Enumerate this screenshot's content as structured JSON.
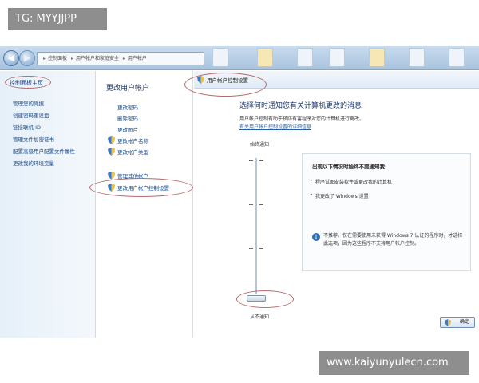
{
  "watermarks": {
    "top": "TG: MYYJJPP",
    "bottom": "www.kaiyunyulecn.com"
  },
  "addressbar": {
    "back_glyph": "◀",
    "forward_glyph": "▶",
    "segments": [
      "控制面板",
      "用户帐户和家庭安全",
      "用户帐户"
    ]
  },
  "left_nav": {
    "home": "控制面板主页",
    "items": [
      "管理您的凭据",
      "创建密码重设盘",
      "链接联机 ID",
      "管理文件加密证书",
      "配置高级用户配置文件属性",
      "更改我的环境变量"
    ]
  },
  "middle": {
    "title": "更改用户帐户",
    "links": [
      "更改密码",
      "删除密码",
      "更改图片",
      "更改帐户名称",
      "更改帐户类型",
      "管理其他帐户",
      "更改用户帐户控制设置"
    ]
  },
  "uac": {
    "header": "用户帐户控制设置",
    "heading": "选择何时通知您有关计算机更改的消息",
    "description": "用户帐户控制有助于预防有害程序对您的计算机进行更改。",
    "link": "有关用户帐户控制设置的详细信息",
    "slider": {
      "top_label": "始终通知",
      "bottom_label": "从不通知",
      "level": 0,
      "levels": 4
    },
    "info": {
      "heading": "出现以下情况时始终不要通知我:",
      "bullets": [
        "程序试图安装软件或更改我的计算机",
        "我更改了 Windows 设置"
      ],
      "note": "不推荐。仅在需要使用未获得 Windows 7 认证的程序时，才选择此选项，因为这些程序不支持用户帐户控制。"
    },
    "ok_button": "确定"
  },
  "colors": {
    "link": "#1a4c8e",
    "annotation": "#b66a6a",
    "heading": "#1e3b6f"
  },
  "icons": {
    "shield": "uac-shield-icon",
    "info": "info-icon"
  }
}
